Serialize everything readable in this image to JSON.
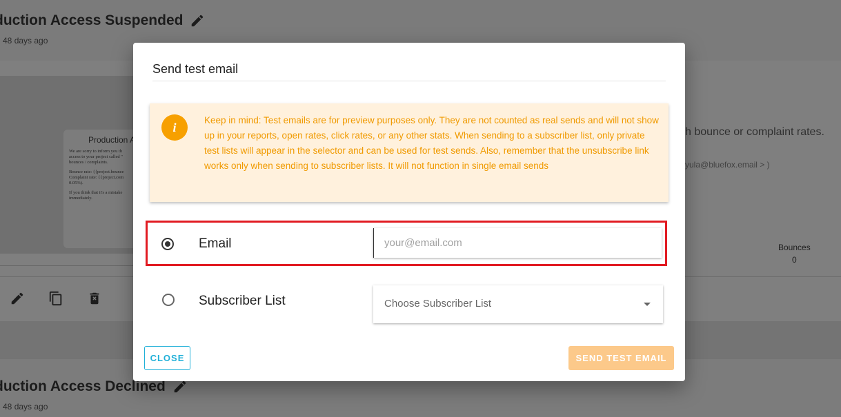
{
  "background": {
    "card1_title": "duction Access Suspended",
    "card1_subtitle": "d 48 days ago",
    "card2_title": "duction Access Declined",
    "card2_subtitle": "d 48 days ago",
    "preview_heading": "Production A",
    "preview_p1": "We are sorry to inform you th access to your project called \" bounces / complaints.",
    "preview_p2": "Bounce rate: {{project.bounce Complaint rate: {{project.com 0.05%).",
    "preview_p3": "If you think that it's a mistake immediately.",
    "right_text": "h bounce or complaint rates.",
    "right_text2": "yula@bluefox.email > )",
    "bounces_label": "Bounces",
    "bounces_value": "0"
  },
  "dialog": {
    "title": "Send test email",
    "notice": "Keep in mind: Test emails are for preview purposes only. They are not counted as real sends and will not show up in your reports, open rates, click rates, or any other stats. When sending to a subscriber list, only private test lists will appear in the selector and can be used for test sends. Also, remember that the unsubscribe link works only when sending to subscriber lists. It will not function in single email sends",
    "notice_icon": "i",
    "email_option": {
      "label": "Email",
      "selected": true,
      "placeholder": "your@email.com",
      "value": ""
    },
    "list_option": {
      "label": "Subscriber List",
      "selected": false,
      "placeholder": "Choose Subscriber List"
    },
    "close_label": "CLOSE",
    "send_label": "SEND TEST EMAIL"
  },
  "colors": {
    "accent": "#20b0d8",
    "warning_text": "#f09a00",
    "warning_bg": "#fff1dd",
    "send_disabled": "#fcc98a",
    "highlight_border": "#e11b22"
  }
}
